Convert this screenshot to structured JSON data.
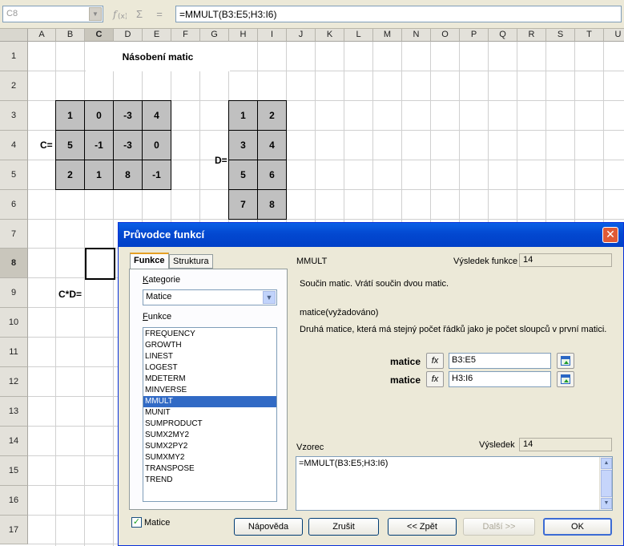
{
  "formula_bar": {
    "cell_ref": "C8",
    "wizard_icon": "function-wizard-icon",
    "sum_symbol": "Σ",
    "equals_symbol": "=",
    "formula": "=MMULT(B3:E5;H3:I6)"
  },
  "sheet": {
    "columns": [
      "A",
      "B",
      "C",
      "D",
      "E",
      "F",
      "G",
      "H",
      "I",
      "J",
      "K",
      "L",
      "M",
      "N",
      "O",
      "P",
      "Q",
      "R",
      "S",
      "T",
      "U"
    ],
    "rows": [
      "1",
      "2",
      "3",
      "4",
      "5",
      "6",
      "7",
      "8",
      "9",
      "10",
      "11",
      "12",
      "13",
      "14",
      "15",
      "16",
      "17"
    ],
    "selected_col": "C",
    "selected_row": "8",
    "title": "Násobení matic",
    "label_c": "C=",
    "label_d": "D=",
    "label_cd": "C*D=",
    "matrix_c": [
      [
        "1",
        "0",
        "-3",
        "4"
      ],
      [
        "5",
        "-1",
        "-3",
        "0"
      ],
      [
        "2",
        "1",
        "8",
        "-1"
      ]
    ],
    "matrix_d": [
      [
        "1",
        "2"
      ],
      [
        "3",
        "4"
      ],
      [
        "5",
        "6"
      ],
      [
        "7",
        "8"
      ]
    ]
  },
  "dialog": {
    "title": "Průvodce funkcí",
    "tabs": [
      "Funkce",
      "Struktura"
    ],
    "category_label": "Kategorie",
    "category_value": "Matice",
    "functions_label": "Funkce",
    "functions": [
      "FREQUENCY",
      "GROWTH",
      "LINEST",
      "LOGEST",
      "MDETERM",
      "MINVERSE",
      "MMULT",
      "MUNIT",
      "SUMPRODUCT",
      "SUMX2MY2",
      "SUMX2PY2",
      "SUMXMY2",
      "TRANSPOSE",
      "TREND"
    ],
    "selected_function": "MMULT",
    "function_name": "MMULT",
    "result_label": "Výsledek funkce",
    "result_value": "14",
    "description": "Součin matic. Vrátí součin dvou matic.",
    "param_heading": "matice(vyžadováno)",
    "param_description": "Druhá matice, která má stejný počet řádků jako je počet sloupců v první matici.",
    "args": [
      {
        "label": "matice",
        "value": "B3:E5"
      },
      {
        "label": "matice",
        "value": "H3:I6"
      }
    ],
    "fx_label": "fx",
    "formula_label": "Vzorec",
    "result2_label": "Výsledek",
    "result2_value": "14",
    "formula_text": "=MMULT(B3:E5;H3:I6)",
    "array_checkbox_label": "Matice",
    "buttons": {
      "help": "Nápověda",
      "cancel": "Zrušit",
      "back": "<< Zpět",
      "next": "Další >>",
      "ok": "OK"
    }
  }
}
